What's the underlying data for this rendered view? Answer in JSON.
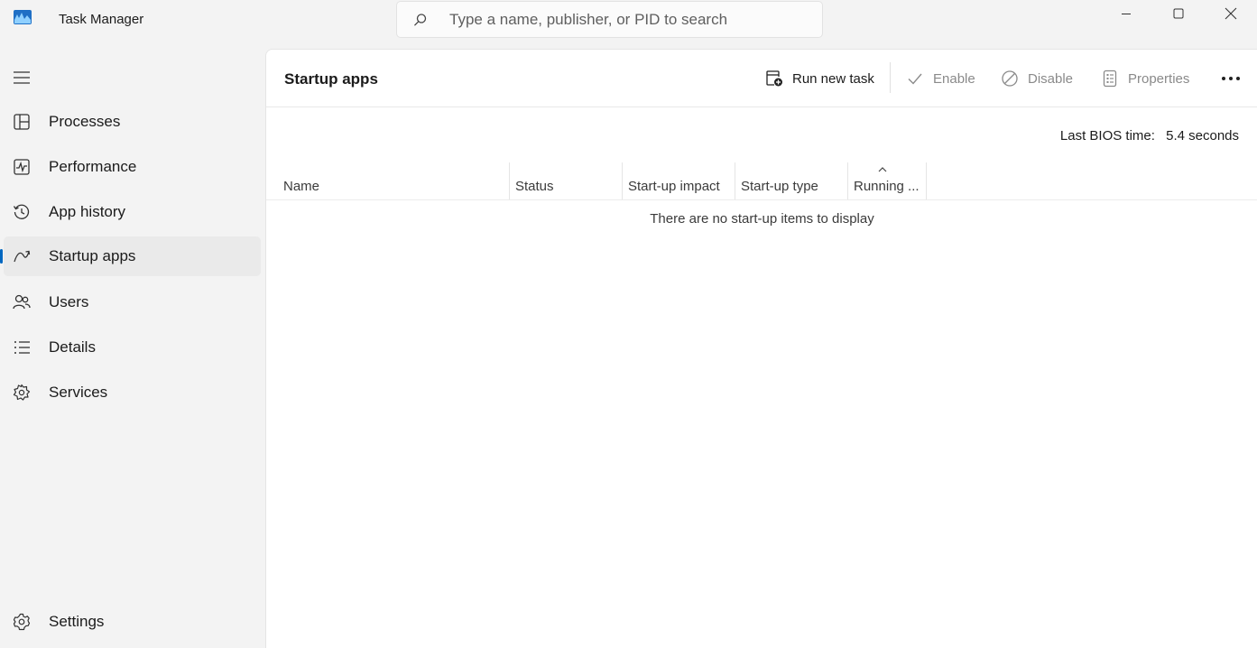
{
  "app": {
    "title": "Task Manager",
    "accent_color": "#0067c0"
  },
  "search": {
    "placeholder": "Type a name, publisher, or PID to search",
    "value": ""
  },
  "sidebar": {
    "items": [
      {
        "label": "Processes",
        "icon": "processes-icon"
      },
      {
        "label": "Performance",
        "icon": "performance-icon"
      },
      {
        "label": "App history",
        "icon": "app-history-icon"
      },
      {
        "label": "Startup apps",
        "icon": "startup-apps-icon",
        "active": true
      },
      {
        "label": "Users",
        "icon": "users-icon"
      },
      {
        "label": "Details",
        "icon": "details-icon"
      },
      {
        "label": "Services",
        "icon": "services-icon"
      }
    ],
    "settings_label": "Settings"
  },
  "main": {
    "title": "Startup apps",
    "toolbar": {
      "run_new_task": "Run new task",
      "enable": "Enable",
      "disable": "Disable",
      "properties": "Properties"
    },
    "bios_label": "Last BIOS time:",
    "bios_value": "5.4 seconds",
    "columns": [
      "Name",
      "Status",
      "Start-up impact",
      "Start-up type",
      "Running ..."
    ],
    "sorted_column": "Running ...",
    "empty_message": "There are no start-up items to display"
  }
}
